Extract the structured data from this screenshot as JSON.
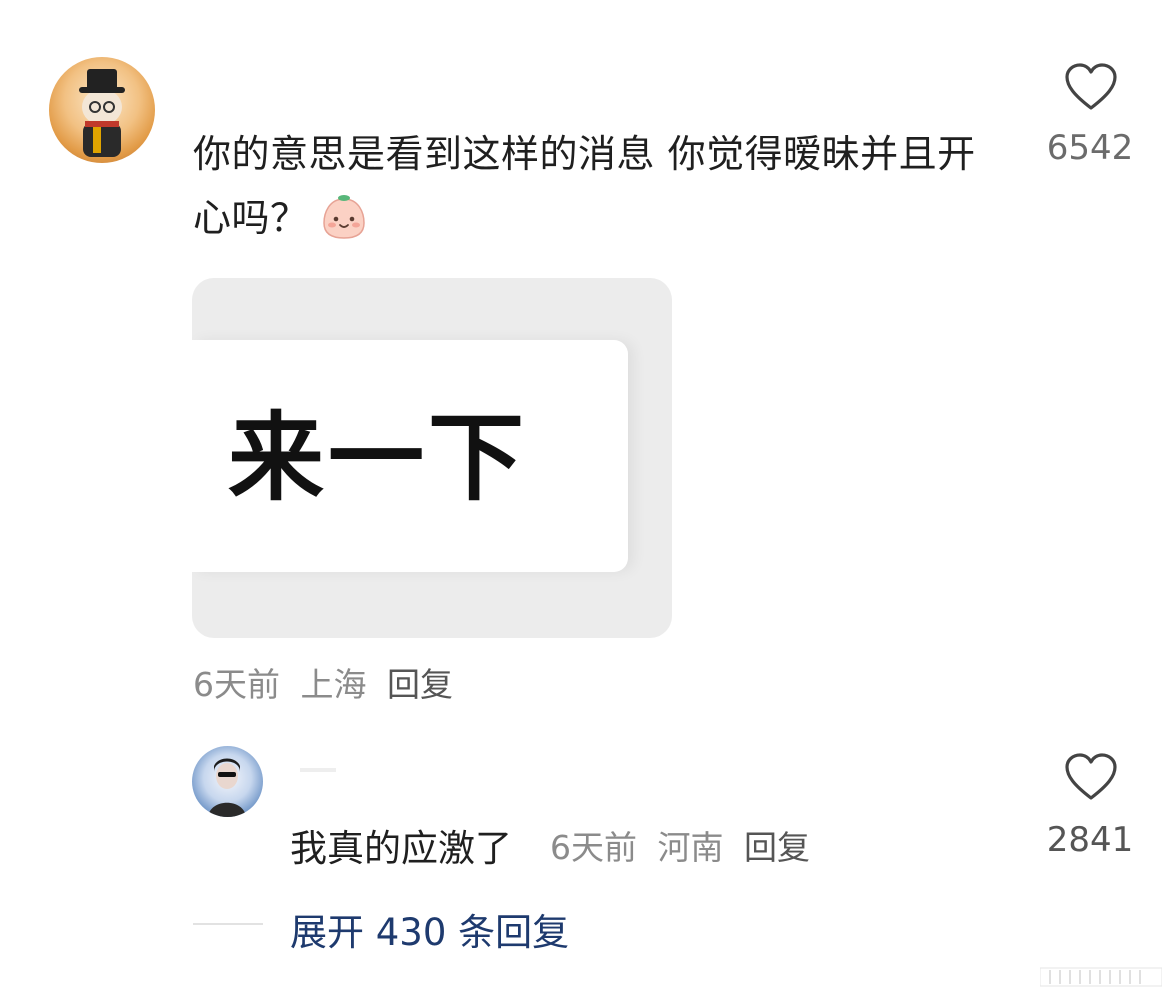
{
  "comment": {
    "text": "你的意思是看到这样的消息 你觉得暧昧并且开心吗？",
    "emoji": "peach-face-emoji",
    "like_count": "6542",
    "image_text": "来一下",
    "meta": {
      "time": "6天前",
      "location": "上海",
      "reply_label": "回复"
    }
  },
  "reply": {
    "text": "我真的应激了",
    "time": "6天前",
    "location": "河南",
    "reply_label": "回复",
    "like_count": "2841"
  },
  "expand": {
    "label": "展开 430 条回复"
  },
  "colors": {
    "meta_gray": "#8b8b8b",
    "link_blue": "#1e3a6e",
    "text_dark": "#1f1f1f"
  }
}
